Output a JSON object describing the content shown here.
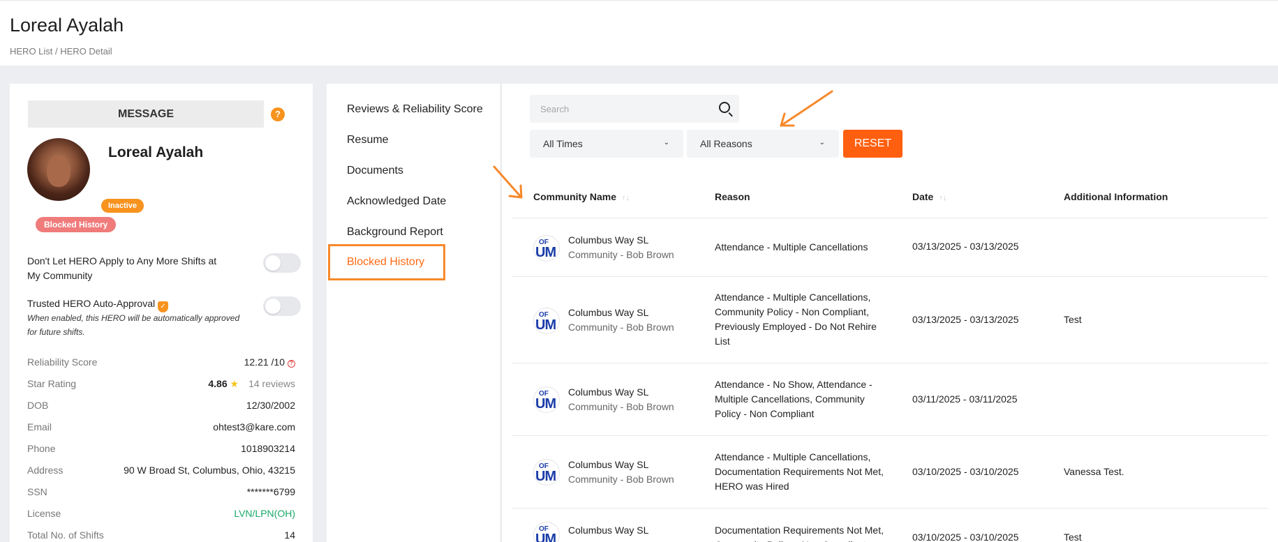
{
  "header": {
    "title": "Loreal Ayalah",
    "breadcrumb": "HERO List / HERO Detail"
  },
  "profile": {
    "message_label": "MESSAGE",
    "help_icon": "?",
    "name": "Loreal Ayalah",
    "status_badge": "Inactive",
    "blocked_badge": "Blocked History",
    "toggle1_label": "Don't Let HERO Apply to Any More Shifts at My Community",
    "toggle2_label": "Trusted HERO Auto-Approval",
    "toggle2_note": "When enabled, this HERO will be automatically approved for future shifts.",
    "info": {
      "reliability": {
        "label": "Reliability Score",
        "value": "12.21 /10"
      },
      "star": {
        "label": "Star Rating",
        "value": "4.86",
        "star": "★",
        "reviews": "14 reviews"
      },
      "dob": {
        "label": "DOB",
        "value": "12/30/2002"
      },
      "email": {
        "label": "Email",
        "value": "ohtest3@kare.com"
      },
      "phone": {
        "label": "Phone",
        "value": "1018903214"
      },
      "address": {
        "label": "Address",
        "value": "90 W Broad St, Columbus, Ohio, 43215"
      },
      "ssn": {
        "label": "SSN",
        "value": "*******6799"
      },
      "license": {
        "label": "License",
        "value": "LVN/LPN(OH)"
      },
      "shifts": {
        "label": "Total No. of Shifts",
        "value": "14"
      }
    }
  },
  "nav": {
    "items": [
      "Reviews & Reliability Score",
      "Resume",
      "Documents",
      "Acknowledged Date",
      "Background Report"
    ],
    "active": "Blocked History"
  },
  "filters": {
    "search_placeholder": "Search",
    "times": "All Times",
    "reasons": "All Reasons",
    "reset": "RESET"
  },
  "table": {
    "headers": {
      "community": "Community Name",
      "reason": "Reason",
      "date": "Date",
      "additional": "Additional Information"
    },
    "logo": {
      "top": "OF",
      "bottom": "UM"
    },
    "rows": [
      {
        "community": "Columbus Way SL",
        "sub": "Community - Bob Brown",
        "reason": "Attendance - Multiple Cancellations",
        "date": "03/13/2025 - 03/13/2025",
        "additional": ""
      },
      {
        "community": "Columbus Way SL",
        "sub": "Community - Bob Brown",
        "reason": "Attendance - Multiple Cancellations, Community Policy - Non Compliant, Previously Employed - Do Not Rehire List",
        "date": "03/13/2025 - 03/13/2025",
        "additional": "Test"
      },
      {
        "community": "Columbus Way SL",
        "sub": "Community - Bob Brown",
        "reason": "Attendance - No Show, Attendance - Multiple Cancellations, Community Policy - Non Compliant",
        "date": "03/11/2025 - 03/11/2025",
        "additional": ""
      },
      {
        "community": "Columbus Way SL",
        "sub": "Community - Bob Brown",
        "reason": "Attendance - Multiple Cancellations, Documentation Requirements Not Met, HERO was Hired",
        "date": "03/10/2025 - 03/10/2025",
        "additional": "Vanessa Test."
      },
      {
        "community": "Columbus Way SL",
        "sub": "",
        "reason": "Documentation Requirements Not Met, Community Policy - Non Compliant",
        "date": "03/10/2025 - 03/10/2025",
        "additional": "Test"
      }
    ]
  },
  "colors": {
    "accent": "#ff5f0f",
    "annotation": "#f7892b",
    "license": "#19a869"
  }
}
